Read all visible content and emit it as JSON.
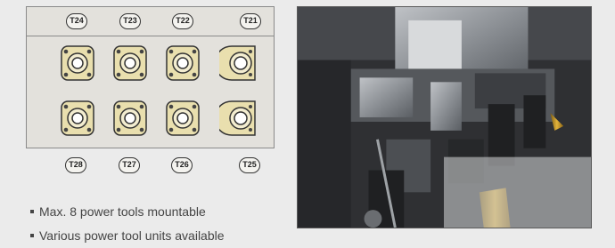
{
  "diagram": {
    "top_labels": [
      "T24",
      "T23",
      "T22",
      "T21"
    ],
    "bottom_labels": [
      "T28",
      "T27",
      "T26",
      "T25"
    ]
  },
  "features": [
    "Max. 8 power tools mountable",
    "Various power tool units available"
  ],
  "colors": {
    "panel_bg": "#e3e1dc",
    "holder_fill": "#e9dfae",
    "page_bg": "#ebebeb",
    "photo_bg": "#3a3b3d"
  }
}
